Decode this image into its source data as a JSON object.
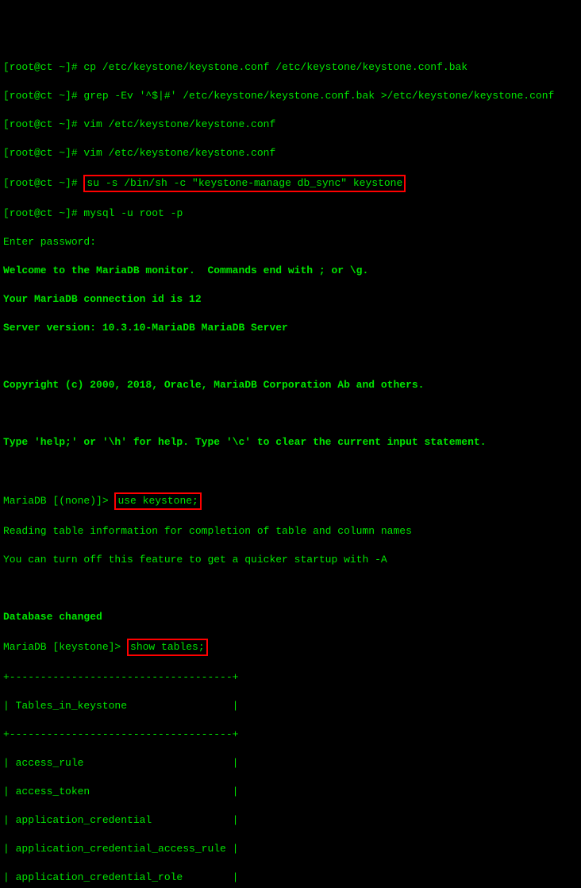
{
  "prompt_root": "[root@ct ~]# ",
  "cmds": {
    "cp": "cp /etc/keystone/keystone.conf /etc/keystone/keystone.conf.bak",
    "grep": "grep -Ev '^$|#' /etc/keystone/keystone.conf.bak >/etc/keystone/keystone.conf",
    "vim1": "vim /etc/keystone/keystone.conf",
    "vim2": "vim /etc/keystone/keystone.conf",
    "su_db_sync": "su -s /bin/sh -c \"keystone-manage db_sync\" keystone",
    "mysql": "mysql -u root -p"
  },
  "login": {
    "enter_pw": "Enter password:",
    "welcome": "Welcome to the MariaDB monitor.  Commands end with ; or \\g.",
    "conn_id": "Your MariaDB connection id is 12",
    "version": "Server version: 10.3.10-MariaDB MariaDB Server",
    "copyright": "Copyright (c) 2000, 2018, Oracle, MariaDB Corporation Ab and others.",
    "help": "Type 'help;' or '\\h' for help. Type '\\c' to clear the current input statement."
  },
  "mariadb": {
    "prompt_none": "MariaDB [(none)]> ",
    "use_cmd": "use keystone;",
    "reading": "Reading table information for completion of table and column names",
    "turnoff": "You can turn off this feature to get a quicker startup with -A",
    "db_changed": "Database changed",
    "prompt_keystone": "MariaDB [keystone]> ",
    "show_cmd": "show tables;"
  },
  "table": {
    "border": "+------------------------------------+",
    "header": "| Tables_in_keystone                 |",
    "rows": [
      "| access_rule                        |",
      "| access_token                       |",
      "| application_credential             |",
      "| application_credential_access_rule |",
      "| application_credential_role        |"
    ]
  }
}
